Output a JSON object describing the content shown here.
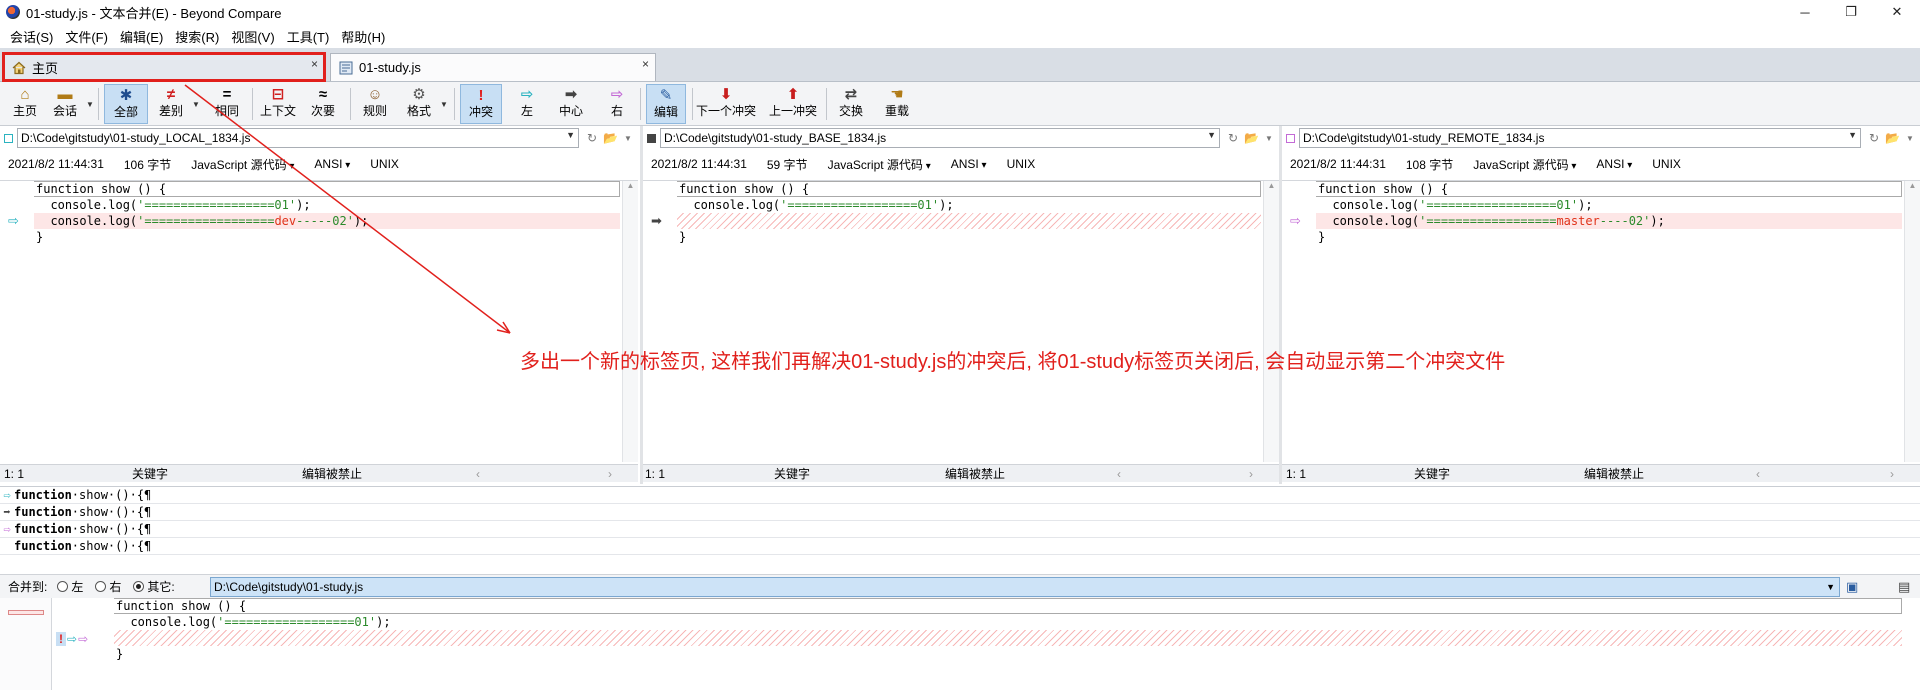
{
  "window": {
    "title": "01-study.js - 文本合并(E) - Beyond Compare",
    "minimize": "─",
    "maximize": "❐",
    "close": "✕"
  },
  "menu": [
    "会话(S)",
    "文件(F)",
    "编辑(E)",
    "搜索(R)",
    "视图(V)",
    "工具(T)",
    "帮助(H)"
  ],
  "tabs": [
    {
      "label": "主页",
      "icon": "home-icon",
      "close": "×"
    },
    {
      "label": "01-study.js",
      "icon": "merge-doc-icon",
      "close": "×"
    }
  ],
  "toolbar": {
    "home": "主页",
    "session": "会话",
    "all": "全部",
    "diffs": "差别",
    "same": "相同",
    "context": "上下文",
    "minor": "次要",
    "rules": "规则",
    "format": "格式",
    "conflicts": "冲突",
    "left": "左",
    "center": "中心",
    "right": "右",
    "edit": "编辑",
    "next_conflict": "下一个冲突",
    "prev_conflict": "上一冲突",
    "swap": "交换",
    "reload": "重载"
  },
  "panes": [
    {
      "path": "D:\\Code\\gitstudy\\01-study_LOCAL_1834.js",
      "marker_color": "#2bb3c0",
      "date": "2021/8/2 11:44:31",
      "size": "106 字节",
      "format": "JavaScript 源代码",
      "encoding": "ANSI",
      "eol": "UNIX",
      "lines": {
        "l1": "function show () {",
        "l2a": "  console.log(",
        "l2b": "'==================01'",
        "l2c": ");",
        "l3a": "  console.log(",
        "l3b": "'==================",
        "l3c": "dev",
        "l3d": "-----02'",
        "l3e": ");",
        "l4": "}"
      },
      "status": {
        "pos": "1: 1",
        "keyword": "关键字",
        "edit": "编辑被禁止"
      }
    },
    {
      "path": "D:\\Code\\gitstudy\\01-study_BASE_1834.js",
      "marker_color": "#444444",
      "date": "2021/8/2 11:44:31",
      "size": "59 字节",
      "format": "JavaScript 源代码",
      "encoding": "ANSI",
      "eol": "UNIX",
      "lines": {
        "l1": "function show () {",
        "l2a": "  console.log(",
        "l2b": "'==================01'",
        "l2c": ");",
        "l4": "}"
      },
      "status": {
        "pos": "1: 1",
        "keyword": "关键字",
        "edit": "编辑被禁止"
      }
    },
    {
      "path": "D:\\Code\\gitstudy\\01-study_REMOTE_1834.js",
      "marker_color": "#c36ad6",
      "date": "2021/8/2 11:44:31",
      "size": "108 字节",
      "format": "JavaScript 源代码",
      "encoding": "ANSI",
      "eol": "UNIX",
      "lines": {
        "l1": "function show () {",
        "l2a": "  console.log(",
        "l2b": "'==================01'",
        "l2c": ");",
        "l3a": "  console.log(",
        "l3b": "'==================",
        "l3c": "master",
        "l3d": "----02'",
        "l3e": ");",
        "l4": "}"
      },
      "status": {
        "pos": "1: 1",
        "keyword": "关键字",
        "edit": "编辑被禁止"
      }
    }
  ],
  "overview": [
    {
      "arrow": "⇨",
      "kw": "function",
      "rest": "·show·()·{¶"
    },
    {
      "arrow": "➡",
      "kw": "function",
      "rest": "·show·()·{¶"
    },
    {
      "arrow": "⇨",
      "kw": "function",
      "rest": "·show·()·{¶"
    },
    {
      "arrow": "",
      "kw": "function",
      "rest": "·show·()·{¶"
    }
  ],
  "merge": {
    "label": "合并到:",
    "opt_left": "左",
    "opt_right": "右",
    "opt_other": "其它:",
    "selected": "其它",
    "path": "D:\\Code\\gitstudy\\01-study.js"
  },
  "output": {
    "l1": "function show () {",
    "l2a": "  console.log(",
    "l2b": "'==================01'",
    "l2c": ");",
    "l4": "}",
    "conflict_mark": "!"
  },
  "annotation": {
    "text": "多出一个新的标签页, 这样我们再解决01-study.js的冲突后, 将01-study标签页关闭后, 会自动显示第二个冲突文件",
    "color": "#e1201c"
  }
}
